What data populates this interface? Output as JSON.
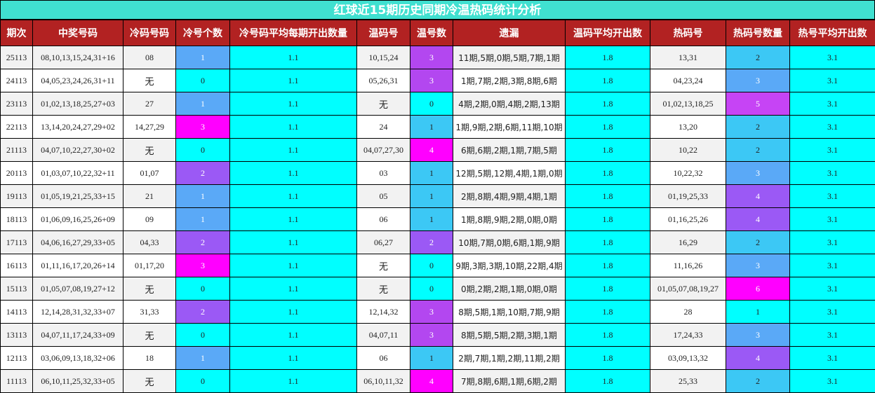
{
  "title": "红球近15期历史同期冷温热码统计分析",
  "headers": [
    "期次",
    "中奖号码",
    "冷码号码",
    "冷号个数",
    "冷号码平均每期开出数量",
    "温码号",
    "温号数",
    "遗漏",
    "温码平均开出数",
    "热码号",
    "热码号数量",
    "热号平均开出数"
  ],
  "colors": {
    "header_bg": "#b22222",
    "title_bg": "#40e0d0",
    "row_bg_odd": "#f2f2f2",
    "row_bg_even": "#ffffff",
    "cyan": "#00ffff",
    "count_palette": {
      "0": "#00ffff",
      "1": "#5aa9f7",
      "2": "#9b59f5",
      "3": "#ff00ff"
    },
    "warm_count_palette": {
      "0": "#00ffff",
      "1": "#3cc8f5",
      "2": "#9b59f5",
      "3": "#b347f0",
      "4": "#ff00ff"
    },
    "hot_count_palette": {
      "1": "#00ffff",
      "2": "#3cc8f5",
      "3": "#5aa9f7",
      "4": "#9b59f5",
      "5": "#c644f5",
      "6": "#ff00ff"
    }
  },
  "rows": [
    {
      "period": "25113",
      "numbers": "08,10,13,15,24,31+16",
      "cold": "08",
      "cold_count": "1",
      "cold_avg": "1.1",
      "warm": "10,15,24",
      "warm_count": "3",
      "miss": "11期,5期,0期,5期,7期,1期",
      "warm_avg": "1.8",
      "hot": "13,31",
      "hot_count": "2",
      "hot_avg": "3.1"
    },
    {
      "period": "24113",
      "numbers": "04,05,23,24,26,31+11",
      "cold": "无",
      "cold_count": "0",
      "cold_avg": "1.1",
      "warm": "05,26,31",
      "warm_count": "3",
      "miss": "1期,7期,2期,3期,8期,6期",
      "warm_avg": "1.8",
      "hot": "04,23,24",
      "hot_count": "3",
      "hot_avg": "3.1"
    },
    {
      "period": "23113",
      "numbers": "01,02,13,18,25,27+03",
      "cold": "27",
      "cold_count": "1",
      "cold_avg": "1.1",
      "warm": "无",
      "warm_count": "0",
      "miss": "4期,2期,0期,4期,2期,13期",
      "warm_avg": "1.8",
      "hot": "01,02,13,18,25",
      "hot_count": "5",
      "hot_avg": "3.1"
    },
    {
      "period": "22113",
      "numbers": "13,14,20,24,27,29+02",
      "cold": "14,27,29",
      "cold_count": "3",
      "cold_avg": "1.1",
      "warm": "24",
      "warm_count": "1",
      "miss": "1期,9期,2期,6期,11期,10期",
      "warm_avg": "1.8",
      "hot": "13,20",
      "hot_count": "2",
      "hot_avg": "3.1"
    },
    {
      "period": "21113",
      "numbers": "04,07,10,22,27,30+02",
      "cold": "无",
      "cold_count": "0",
      "cold_avg": "1.1",
      "warm": "04,07,27,30",
      "warm_count": "4",
      "miss": "6期,6期,2期,1期,7期,5期",
      "warm_avg": "1.8",
      "hot": "10,22",
      "hot_count": "2",
      "hot_avg": "3.1"
    },
    {
      "period": "20113",
      "numbers": "01,03,07,10,22,32+11",
      "cold": "01,07",
      "cold_count": "2",
      "cold_avg": "1.1",
      "warm": "03",
      "warm_count": "1",
      "miss": "12期,5期,12期,4期,1期,0期",
      "warm_avg": "1.8",
      "hot": "10,22,32",
      "hot_count": "3",
      "hot_avg": "3.1"
    },
    {
      "period": "19113",
      "numbers": "01,05,19,21,25,33+15",
      "cold": "21",
      "cold_count": "1",
      "cold_avg": "1.1",
      "warm": "05",
      "warm_count": "1",
      "miss": "2期,8期,4期,9期,4期,1期",
      "warm_avg": "1.8",
      "hot": "01,19,25,33",
      "hot_count": "4",
      "hot_avg": "3.1"
    },
    {
      "period": "18113",
      "numbers": "01,06,09,16,25,26+09",
      "cold": "09",
      "cold_count": "1",
      "cold_avg": "1.1",
      "warm": "06",
      "warm_count": "1",
      "miss": "1期,8期,9期,2期,0期,0期",
      "warm_avg": "1.8",
      "hot": "01,16,25,26",
      "hot_count": "4",
      "hot_avg": "3.1"
    },
    {
      "period": "17113",
      "numbers": "04,06,16,27,29,33+05",
      "cold": "04,33",
      "cold_count": "2",
      "cold_avg": "1.1",
      "warm": "06,27",
      "warm_count": "2",
      "miss": "10期,7期,0期,6期,1期,9期",
      "warm_avg": "1.8",
      "hot": "16,29",
      "hot_count": "2",
      "hot_avg": "3.1"
    },
    {
      "period": "16113",
      "numbers": "01,11,16,17,20,26+14",
      "cold": "01,17,20",
      "cold_count": "3",
      "cold_avg": "1.1",
      "warm": "无",
      "warm_count": "0",
      "miss": "9期,3期,3期,10期,22期,4期",
      "warm_avg": "1.8",
      "hot": "11,16,26",
      "hot_count": "3",
      "hot_avg": "3.1"
    },
    {
      "period": "15113",
      "numbers": "01,05,07,08,19,27+12",
      "cold": "无",
      "cold_count": "0",
      "cold_avg": "1.1",
      "warm": "无",
      "warm_count": "0",
      "miss": "0期,2期,2期,1期,0期,0期",
      "warm_avg": "1.8",
      "hot": "01,05,07,08,19,27",
      "hot_count": "6",
      "hot_avg": "3.1"
    },
    {
      "period": "14113",
      "numbers": "12,14,28,31,32,33+07",
      "cold": "31,33",
      "cold_count": "2",
      "cold_avg": "1.1",
      "warm": "12,14,32",
      "warm_count": "3",
      "miss": "8期,5期,1期,10期,7期,9期",
      "warm_avg": "1.8",
      "hot": "28",
      "hot_count": "1",
      "hot_avg": "3.1"
    },
    {
      "period": "13113",
      "numbers": "04,07,11,17,24,33+09",
      "cold": "无",
      "cold_count": "0",
      "cold_avg": "1.1",
      "warm": "04,07,11",
      "warm_count": "3",
      "miss": "8期,5期,5期,2期,3期,1期",
      "warm_avg": "1.8",
      "hot": "17,24,33",
      "hot_count": "3",
      "hot_avg": "3.1"
    },
    {
      "period": "12113",
      "numbers": "03,06,09,13,18,32+06",
      "cold": "18",
      "cold_count": "1",
      "cold_avg": "1.1",
      "warm": "06",
      "warm_count": "1",
      "miss": "2期,7期,1期,2期,11期,2期",
      "warm_avg": "1.8",
      "hot": "03,09,13,32",
      "hot_count": "4",
      "hot_avg": "3.1"
    },
    {
      "period": "11113",
      "numbers": "06,10,11,25,32,33+05",
      "cold": "无",
      "cold_count": "0",
      "cold_avg": "1.1",
      "warm": "06,10,11,32",
      "warm_count": "4",
      "miss": "7期,8期,6期,1期,6期,2期",
      "warm_avg": "1.8",
      "hot": "25,33",
      "hot_count": "2",
      "hot_avg": "3.1"
    }
  ]
}
